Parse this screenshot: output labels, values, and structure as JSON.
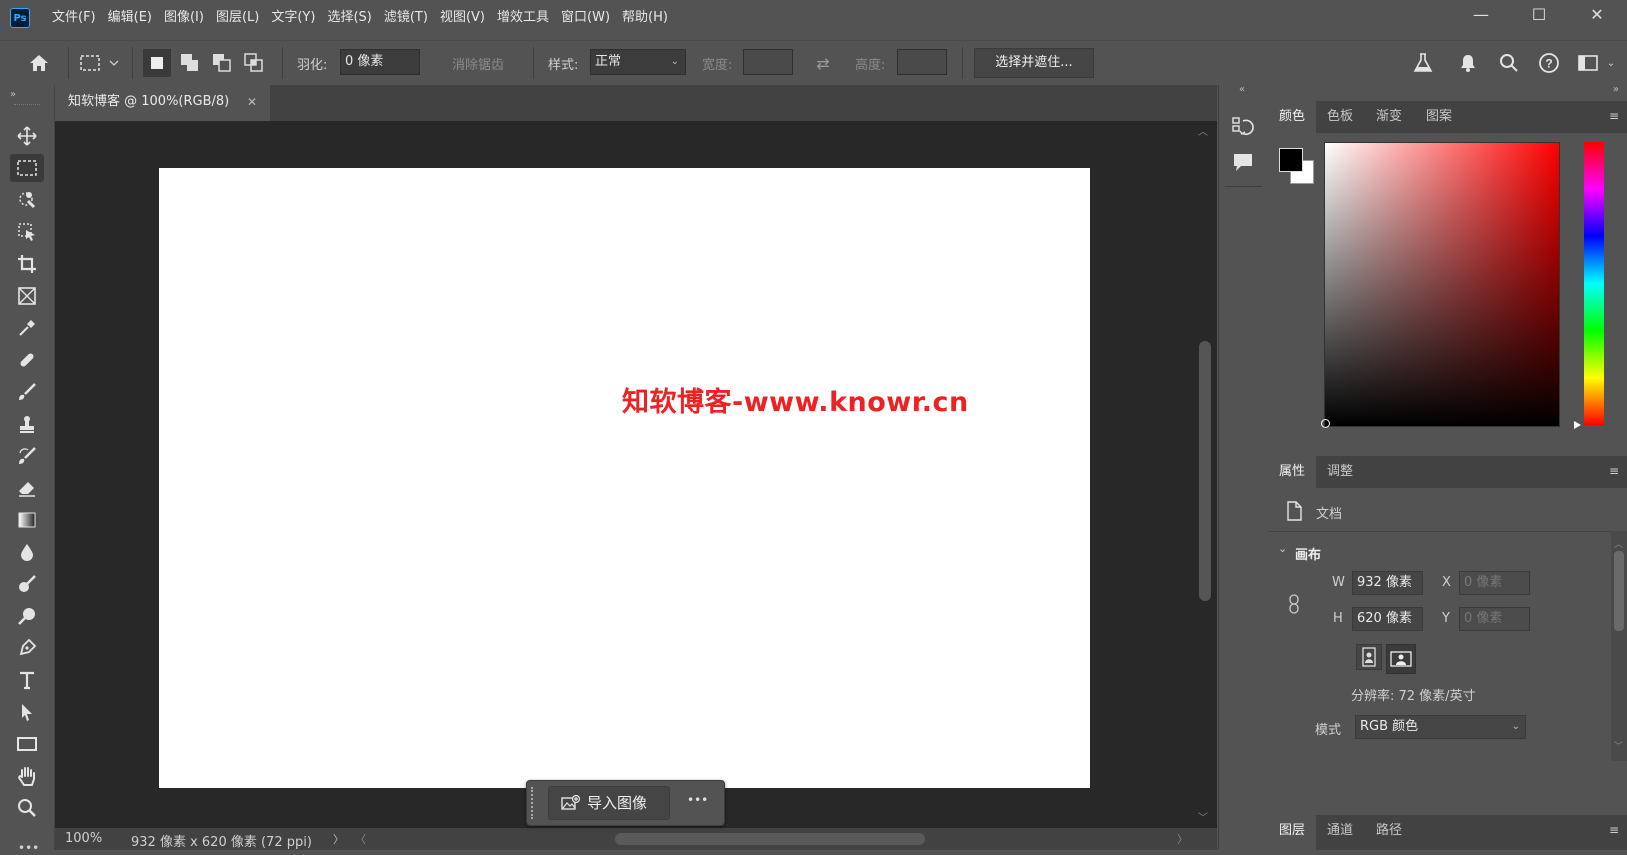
{
  "app": {
    "logo_text": "Ps"
  },
  "menu": [
    "文件(F)",
    "编辑(E)",
    "图像(I)",
    "图层(L)",
    "文字(Y)",
    "选择(S)",
    "滤镜(T)",
    "视图(V)",
    "增效工具",
    "窗口(W)",
    "帮助(H)"
  ],
  "window_controls": {
    "minimize": "—",
    "maximize": "☐",
    "close": "✕"
  },
  "options": {
    "feather_label": "羽化:",
    "feather_value": "0 像素",
    "antialias_label": "消除锯齿",
    "style_label": "样式:",
    "style_value": "正常",
    "width_label": "宽度:",
    "height_label": "高度:",
    "select_mask_button": "选择并遮住..."
  },
  "document": {
    "tab_title": "知软博客 @ 100%(RGB/8)",
    "watermark_text": "知软博客-www.knowr.cn",
    "zoom": "100%",
    "info": "932 像素 x 620 像素 (72 ppi)"
  },
  "context_bar": {
    "import_label": "导入图像",
    "more": "•••"
  },
  "color_panel": {
    "tabs": [
      "颜色",
      "色板",
      "渐变",
      "图案"
    ],
    "foreground": "#000000",
    "background": "#ffffff",
    "picker_hue": "#ff0000"
  },
  "properties_panel": {
    "tabs": [
      "属性",
      "调整"
    ],
    "doc_label": "文档",
    "section_title": "画布",
    "w_label": "W",
    "w_value": "932 像素",
    "h_label": "H",
    "h_value": "620 像素",
    "x_label": "X",
    "x_value": "0 像素",
    "y_label": "Y",
    "y_value": "0 像素",
    "resolution": "分辨率: 72 像素/英寸",
    "mode_label": "模式",
    "mode_value": "RGB 颜色"
  },
  "layers_panel": {
    "tabs": [
      "图层",
      "通道",
      "路径"
    ]
  }
}
